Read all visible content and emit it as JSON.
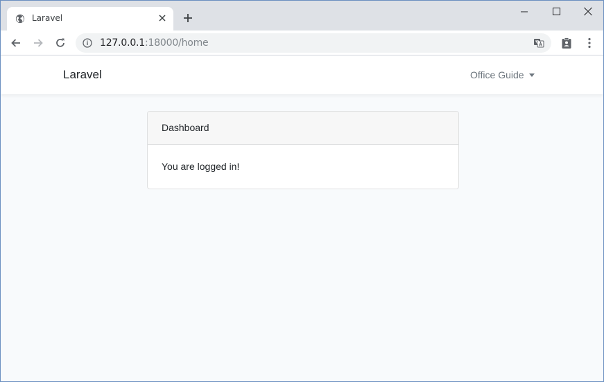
{
  "browser": {
    "tab": {
      "title": "Laravel",
      "favicon": "globe-icon"
    },
    "address": {
      "host": "127.0.0.1",
      "rest": ":18000/home"
    }
  },
  "page": {
    "brand": "Laravel",
    "user_menu": "Office Guide",
    "card": {
      "header": "Dashboard",
      "body": "You are logged in!"
    }
  },
  "colors": {
    "tabstrip": "#dee1e6",
    "page_bg": "#f8fafc",
    "muted_text": "#6c757d"
  }
}
